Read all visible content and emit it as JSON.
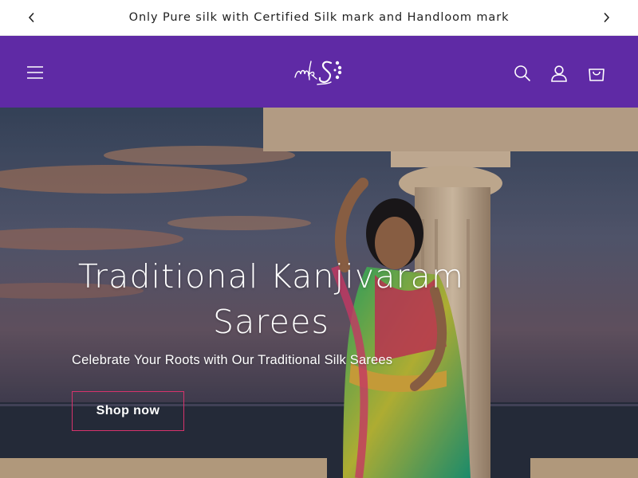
{
  "announcement": {
    "text": "Only Pure silk with Certified Silk mark and Handloom mark",
    "prev_icon": "chevron-left-icon",
    "next_icon": "chevron-right-icon"
  },
  "header": {
    "background": "#5f2aa5",
    "logo_icon": "brand-logo-mks",
    "menu_icon": "hamburger-menu-icon",
    "search_icon": "search-icon",
    "account_icon": "user-icon",
    "cart_icon": "shopping-bag-icon"
  },
  "hero": {
    "title_line1": "Traditional Kanjivaram",
    "title_line2": "Sarees",
    "subtitle": "Celebrate Your Roots with Our Traditional Silk Sarees",
    "cta_label": "Shop now",
    "cta_border_color": "#d6336c"
  }
}
